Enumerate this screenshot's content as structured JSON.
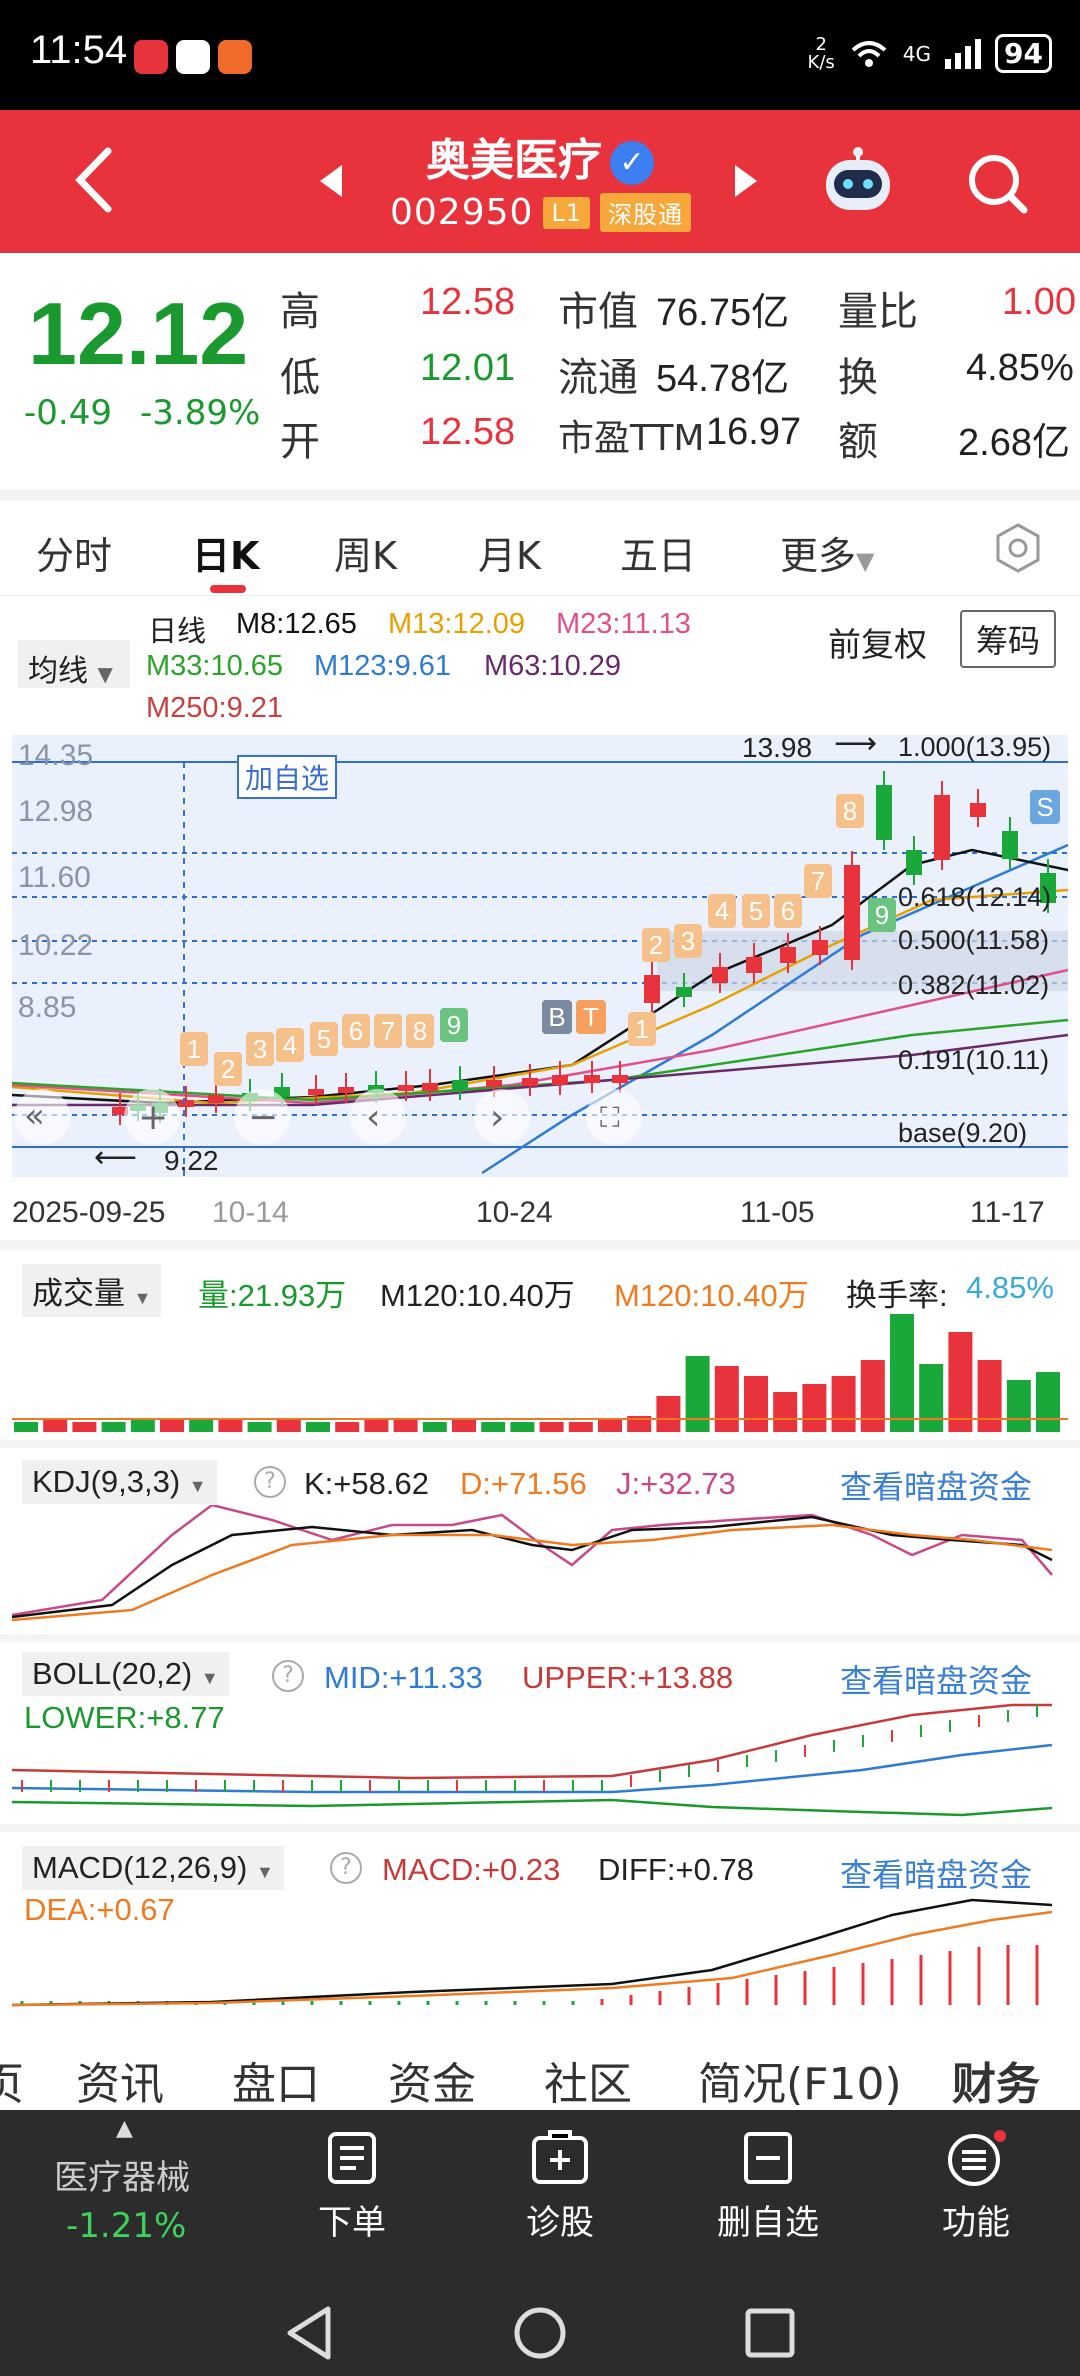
{
  "status": {
    "time": "11:54",
    "net_speed": "2\nK/s",
    "signal": "4G",
    "battery": "94"
  },
  "header": {
    "title": "奥美医疗",
    "code": "002950",
    "level_tag": "L1",
    "market_tag": "深股通"
  },
  "quote": {
    "price": "12.12",
    "change": "-0.49",
    "change_pct": "-3.89%",
    "rows": [
      {
        "l1": "高",
        "v1": "12.58",
        "l2": "市值",
        "v2": "76.75亿",
        "l3": "量比",
        "v3": "1.00"
      },
      {
        "l1": "低",
        "v1": "12.01",
        "l2": "流通",
        "v2": "54.78亿",
        "l3": "换",
        "v3": "4.85%"
      },
      {
        "l1": "开",
        "v1": "12.58",
        "l2": "市盈TTM",
        "v2": "16.97",
        "l3": "额",
        "v3": "2.68亿"
      }
    ],
    "colors": {
      "down": "#1a9a2e",
      "up": "#e8323c"
    }
  },
  "tabs": [
    "分时",
    "日K",
    "周K",
    "月K",
    "五日",
    "更多"
  ],
  "ma": {
    "select": "均线",
    "line_type": "日线",
    "m8": "M8:12.65",
    "m13": "M13:12.09",
    "m23": "M23:11.13",
    "m33": "M33:10.65",
    "m123": "M123:9.61",
    "m63": "M63:10.29",
    "m250": "M250:9.21",
    "adjust": "前复权",
    "chips": "筹码"
  },
  "kline": {
    "add_watch": "加自选",
    "y_ticks": [
      "14.35",
      "12.98",
      "11.60",
      "10.22",
      "8.85"
    ],
    "high_mark": "13.98",
    "low_mark": "9.22",
    "fib": [
      "1.000(13.95)",
      "0.618(12.14)",
      "0.500(11.58)",
      "0.382(11.02)",
      "0.191(10.11)",
      "base(9.20)"
    ],
    "x_labels": [
      "2025-09-25",
      "10-14",
      "10-24",
      "11-05",
      "11-17"
    ],
    "signals": [
      "1",
      "2",
      "3",
      "4",
      "5",
      "6",
      "7",
      "8",
      "9",
      "1",
      "2",
      "3",
      "4",
      "5",
      "6",
      "7",
      "8",
      "9"
    ],
    "bt": [
      "B",
      "T",
      "S"
    ]
  },
  "volume": {
    "select": "成交量",
    "vol": "量:21.93万",
    "m120a": "M120:10.40万",
    "m120b": "M120:10.40万",
    "turnover_label": "换手率:",
    "turnover": "4.85%"
  },
  "kdj": {
    "select": "KDJ(9,3,3)",
    "k": "K:+58.62",
    "d": "D:+71.56",
    "j": "J:+32.73",
    "link": "查看暗盘资金"
  },
  "boll": {
    "select": "BOLL(20,2)",
    "mid": "MID:+11.33",
    "upper": "UPPER:+13.88",
    "lower": "LOWER:+8.77",
    "link": "查看暗盘资金"
  },
  "macd": {
    "select": "MACD(12,26,9)",
    "macd": "MACD:+0.23",
    "diff": "DIFF:+0.78",
    "dea": "DEA:+0.67",
    "link": "查看暗盘资金"
  },
  "footer_tabs": [
    "资讯",
    "盘口",
    "资金",
    "社区",
    "简况(F10)",
    "财务"
  ],
  "nav": {
    "sector": "医疗器械",
    "sector_chg": "-1.21%",
    "order": "下单",
    "diagnose": "诊股",
    "remove_watch": "删自选",
    "func": "功能"
  }
}
